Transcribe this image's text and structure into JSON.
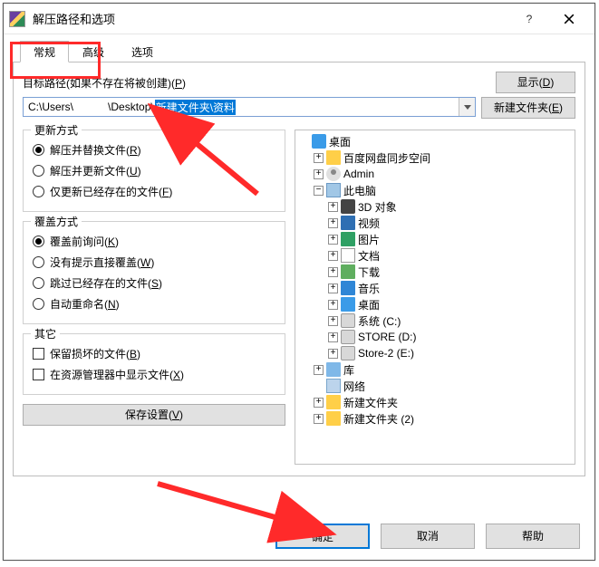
{
  "window": {
    "title": "解压路径和选项",
    "help_button": "?",
    "close_button": "×"
  },
  "tabs": {
    "general": "常规",
    "advanced": "高级",
    "options": "选项"
  },
  "target": {
    "label_prefix": "目标路径",
    "label_suffix": "(如果不存在将被创建)(",
    "label_hotkey": "P",
    "label_end": ")",
    "show_btn_prefix": "显示(",
    "show_btn_hotkey": "D",
    "show_btn_end": ")",
    "newfolder_btn_prefix": "新建文件夹(",
    "newfolder_btn_hotkey": "E",
    "newfolder_btn_end": ")",
    "path_prefix": "C:\\Users\\",
    "path_mid": "\\Desktop\\",
    "path_selected": "新建文件夹\\资料"
  },
  "update_group": {
    "legend": "更新方式",
    "opt1_prefix": "解压并替换文件(",
    "opt1_hot": "R",
    "opt1_end": ")",
    "opt2_prefix": "解压并更新文件(",
    "opt2_hot": "U",
    "opt2_end": ")",
    "opt3_prefix": "仅更新已经存在的文件(",
    "opt3_hot": "F",
    "opt3_end": ")"
  },
  "overwrite_group": {
    "legend": "覆盖方式",
    "opt1_prefix": "覆盖前询问(",
    "opt1_hot": "K",
    "opt1_end": ")",
    "opt2_prefix": "没有提示直接覆盖(",
    "opt2_hot": "W",
    "opt2_end": ")",
    "opt3_prefix": "跳过已经存在的文件(",
    "opt3_hot": "S",
    "opt3_end": ")",
    "opt4_prefix": "自动重命名(",
    "opt4_hot": "N",
    "opt4_end": ")"
  },
  "misc_group": {
    "legend": "其它",
    "opt1_prefix": "保留损坏的文件(",
    "opt1_hot": "B",
    "opt1_end": ")",
    "opt2_prefix": "在资源管理器中显示文件(",
    "opt2_hot": "X",
    "opt2_end": ")"
  },
  "save_btn_prefix": "保存设置(",
  "save_btn_hot": "V",
  "save_btn_end": ")",
  "tree": {
    "root": "桌面",
    "items": [
      "百度网盘同步空间",
      "Admin",
      "此电脑",
      "3D 对象",
      "视频",
      "图片",
      "文档",
      "下载",
      "音乐",
      "桌面",
      "系统 (C:)",
      "STORE (D:)",
      "Store-2 (E:)",
      "库",
      "网络",
      "新建文件夹",
      "新建文件夹 (2)"
    ]
  },
  "footer": {
    "ok": "确定",
    "cancel": "取消",
    "help": "帮助"
  },
  "twist": {
    "plus": "+",
    "minus": "−"
  }
}
